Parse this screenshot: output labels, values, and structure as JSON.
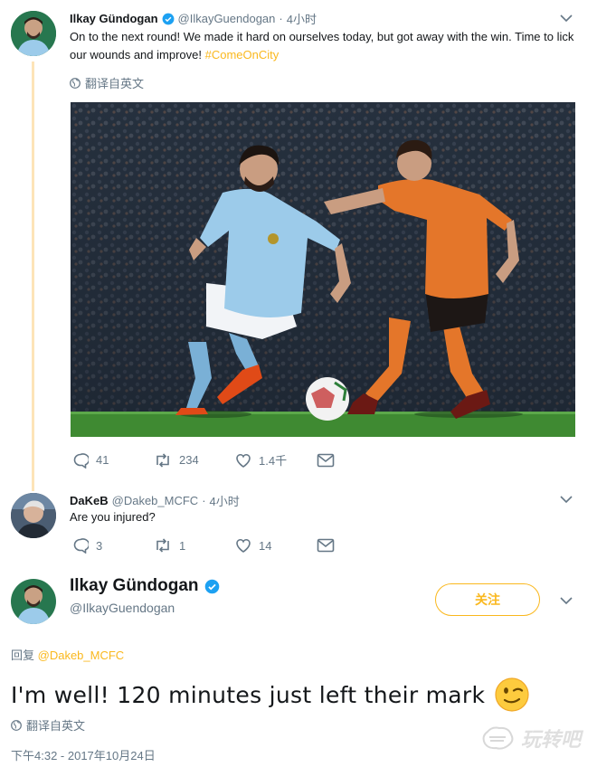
{
  "tweet1": {
    "display_name": "Ilkay Gündogan",
    "handle": "@IlkayGuendogan",
    "time": "4小时",
    "text": "On to the next round! We made it hard on ourselves today, but got away with the win. Time to lick our wounds and improve! ",
    "hashtag": "#ComeOnCity",
    "translate_label": "翻译自英文",
    "replies": "41",
    "retweets": "234",
    "likes": "1.4千",
    "photo_caption": ""
  },
  "reply": {
    "display_name": "DaKeB",
    "handle": "@Dakeb_MCFC",
    "time": "4小时",
    "text": "Are you injured?",
    "replies": "3",
    "retweets": "1",
    "likes": "14"
  },
  "main": {
    "display_name": "Ilkay Gündogan",
    "handle": "@IlkayGuendogan",
    "follow_label": "关注",
    "reply_to_prefix": "回复 ",
    "reply_to_handle": "@Dakeb_MCFC",
    "text": "I'm well! 120 minutes just left their mark",
    "translate_label": "翻译自英文",
    "timestamp": "下午4:32 - 2017年10月24日"
  },
  "watermark": "玩转吧",
  "colors": {
    "accent": "#fab81e",
    "verified": "#1da1f2",
    "muted": "#657786",
    "city_blue": "#9ccbea",
    "wolves_orange": "#e4762a"
  }
}
